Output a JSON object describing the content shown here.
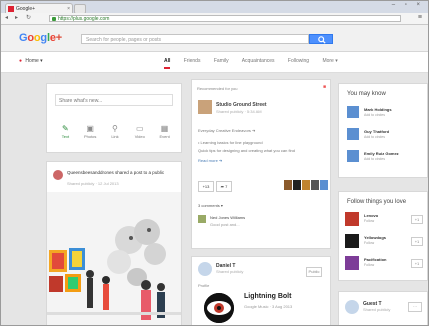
{
  "browser": {
    "tab_title": "Google+",
    "tab_close": "×",
    "window_controls": "– ▫ ×",
    "back": "◂",
    "forward": "▸",
    "reload": "↻",
    "address": "https://plus.google.com",
    "menu": "≡"
  },
  "header": {
    "logo": "Google+",
    "search_placeholder": "Search for people, pages or posts"
  },
  "subnav": {
    "home_label": "Home ▾",
    "tabs": [
      "All",
      "Friends",
      "Family",
      "Acquaintances",
      "Following",
      "More ▾"
    ]
  },
  "share_box": {
    "placeholder": "Share what's new...",
    "actions": [
      "Text",
      "Photos",
      "Link",
      "Video",
      "Event"
    ]
  },
  "post_left": {
    "author": "Queensbeesanddrones shared a post to a public",
    "meta": "Shared publicly · 12 Jul 2013"
  },
  "post_center": {
    "header": "Recommended for you",
    "author": "Studio Ground Street",
    "meta": "Shared publicly · 5:34 AM",
    "line1": "Everyday Creative Endeavors ➔",
    "line2": "• Learning basics for line playground",
    "line3": "Quick tips for designing and creating what you can find",
    "link": "Read more ➔",
    "plus_one": "+13",
    "share": "➦ 7",
    "comments_label": "3 comments ▾",
    "comment_author": "Ned Jones Williams",
    "comment_text": "Good post and..."
  },
  "post_bottom": {
    "author": "Daniel T",
    "time": "Shared publicly",
    "public_btn": "Public",
    "label": "Profile",
    "title": "Lightning Bolt",
    "subtitle": "Google Music · 3 Aug 2013"
  },
  "you_may_know": {
    "title": "You may know",
    "people": [
      {
        "name": "Mark Holdings",
        "action": "Add to circles"
      },
      {
        "name": "Guy Thatford",
        "action": "Add to circles"
      },
      {
        "name": "Emily Ruiz Gomez",
        "action": "Add to circles"
      }
    ]
  },
  "follow_box": {
    "title": "Follow things you love",
    "items": [
      {
        "name": "Lenovo",
        "action": "Follow",
        "add": "+1"
      },
      {
        "name": "Yellowdogs",
        "action": "Follow",
        "add": "+1"
      },
      {
        "name": "Pacification",
        "action": "Follow",
        "add": "+1"
      }
    ]
  },
  "right_bottom": {
    "name": "Guest T",
    "time": "Shared publicly",
    "btn": "···"
  },
  "colors": {
    "accent": "#dd4b39",
    "search_blue": "#4d90fe"
  }
}
